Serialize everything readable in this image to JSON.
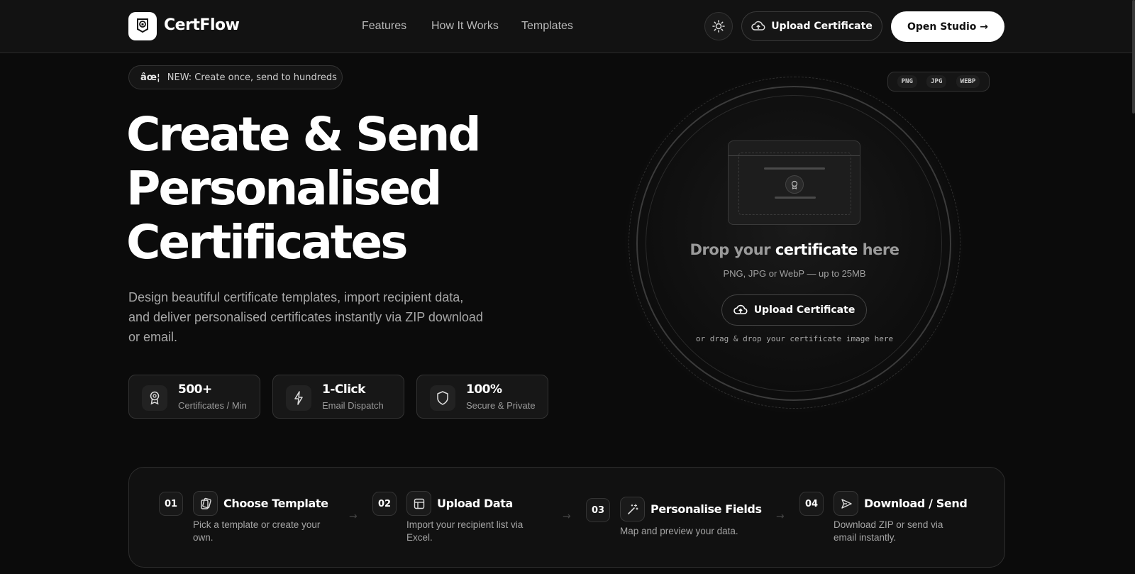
{
  "header": {
    "brand": "CertFlow",
    "nav": [
      "Features",
      "How It Works",
      "Templates"
    ],
    "upload_label": "Upload Certificate",
    "open_studio_label": "Open Studio →"
  },
  "hero": {
    "badge_glyph": "âœ¦",
    "badge_text": "NEW: Create once, send to hundreds",
    "title_line1": "Create & Send",
    "title_line2": "Personalised",
    "title_line3": "Certificates",
    "description": "Design beautiful certificate templates, import recipient data, and deliver personalised certificates instantly via ZIP download or email."
  },
  "stats": [
    {
      "value": "500+",
      "label": "Certificates / Min",
      "icon": "award-icon"
    },
    {
      "value": "1-Click",
      "label": "Email Dispatch",
      "icon": "lightning-icon"
    },
    {
      "value": "100%",
      "label": "Secure & Private",
      "icon": "shield-icon"
    }
  ],
  "upload": {
    "formats": [
      "PNG",
      "JPG",
      "WEBP"
    ],
    "title_pre": "Drop your ",
    "title_highlight": "certificate",
    "title_post": " here",
    "subtitle": "PNG, JPG or WebP — up to 25MB",
    "button_label": "Upload Certificate",
    "hint": "or drag & drop your certificate image here"
  },
  "steps": [
    {
      "num": "01",
      "title": "Choose Template",
      "desc": "Pick a template or create your own.",
      "icon": "template-icon"
    },
    {
      "num": "02",
      "title": "Upload Data",
      "desc": "Import your recipient list via Excel.",
      "icon": "table-icon"
    },
    {
      "num": "03",
      "title": "Personalise Fields",
      "desc": "Map and preview your data.",
      "icon": "magic-wand-icon"
    },
    {
      "num": "04",
      "title": "Download / Send",
      "desc": "Download ZIP or send via email instantly.",
      "icon": "send-icon"
    }
  ],
  "step_arrow": "→",
  "colors": {
    "background": "#0b0b0b",
    "accent": "#ffffff",
    "muted": "#a7a7a7"
  }
}
